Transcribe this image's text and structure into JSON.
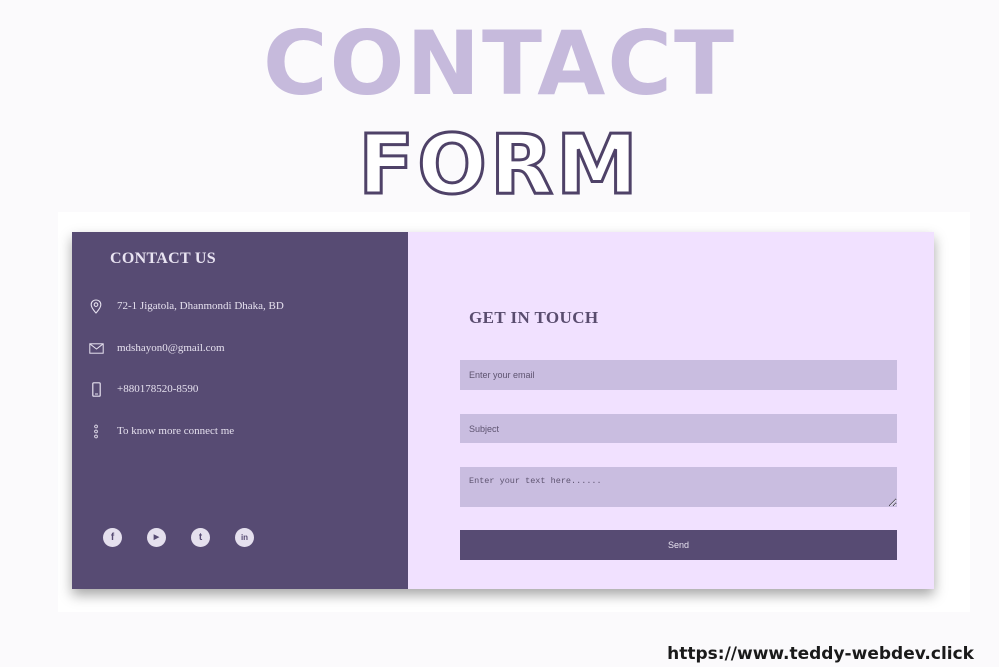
{
  "hero": {
    "line1": "CONTACT",
    "line2": "FORM"
  },
  "contact": {
    "title": "CONTACT US",
    "address": "72-1 Jigatola, Dhanmondi Dhaka, BD",
    "email": "mdshayon0@gmail.com",
    "phone": "+880178520-8590",
    "more": "To know more connect me",
    "socials": [
      {
        "icon": "facebook-icon",
        "glyph": "f"
      },
      {
        "icon": "youtube-icon",
        "glyph": "▶"
      },
      {
        "icon": "twitter-icon",
        "glyph": "t"
      },
      {
        "icon": "linkedin-icon",
        "glyph": "in"
      }
    ]
  },
  "form": {
    "title": "GET IN TOUCH",
    "email_placeholder": "Enter your email",
    "subject_placeholder": "Subject",
    "message_placeholder": "Enter your text here......",
    "send_label": "Send"
  },
  "footer": {
    "url": "https://www.teddy-webdev.click"
  },
  "colors": {
    "panel": "#574b73",
    "form_bg": "#f1e1ff",
    "field": "#c9bde0",
    "hero_fill": "#c6badc"
  }
}
